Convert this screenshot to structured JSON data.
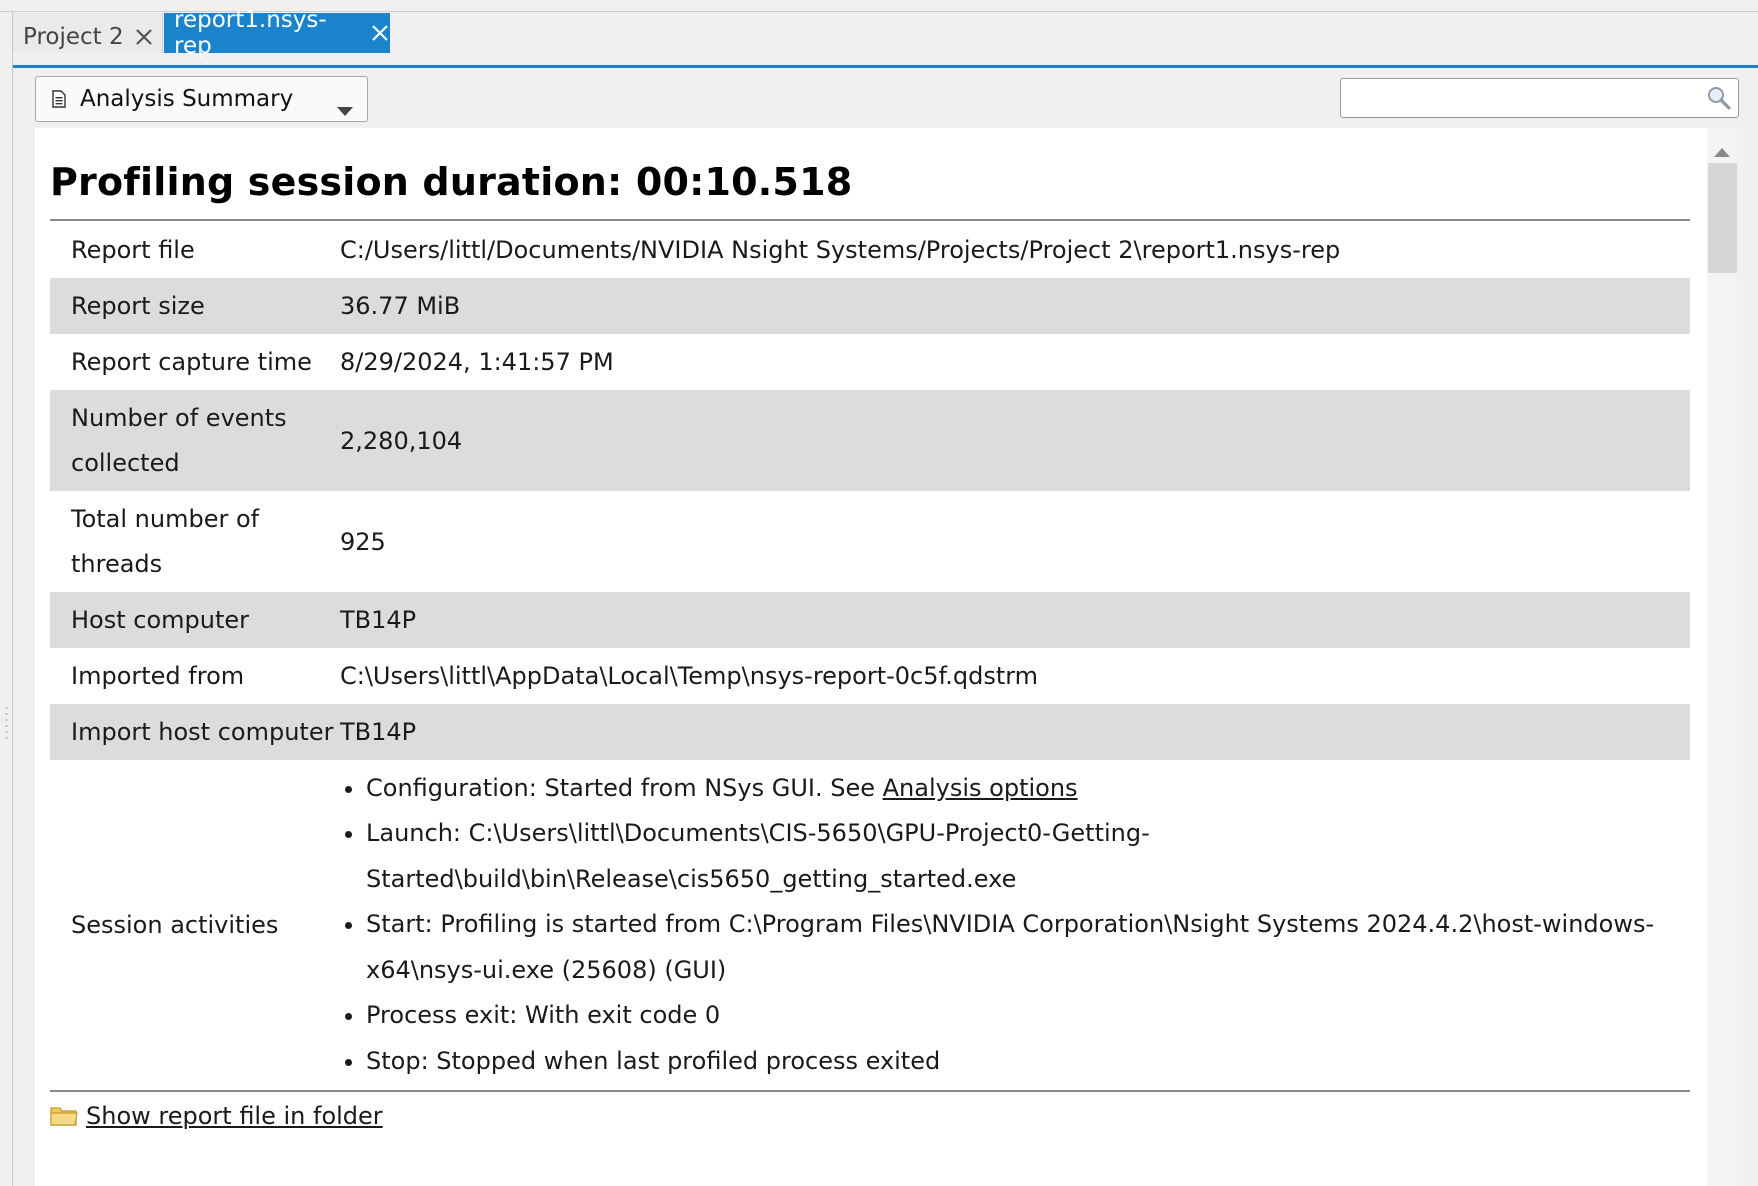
{
  "tabs": [
    {
      "label": "Project 2",
      "active": false
    },
    {
      "label": "report1.nsys-rep",
      "active": true
    }
  ],
  "view_selector": {
    "label": "Analysis Summary"
  },
  "search": {
    "value": "",
    "placeholder": ""
  },
  "summary": {
    "title": "Profiling session duration: 00:10.518",
    "rows": {
      "report_file": {
        "key": "Report file",
        "value": "C:/Users/littl/Documents/NVIDIA Nsight Systems/Projects/Project 2\\report1.nsys-rep"
      },
      "report_size": {
        "key": "Report size",
        "value": "36.77 MiB"
      },
      "capture_time": {
        "key": "Report capture time",
        "value": "8/29/2024, 1:41:57 PM"
      },
      "events": {
        "key_line1": "Number of events",
        "key_line2": "collected",
        "value": "2,280,104"
      },
      "threads": {
        "key_line1": "Total number of",
        "key_line2": "threads",
        "value": "925"
      },
      "host": {
        "key": "Host computer",
        "value": "TB14P"
      },
      "imported_from": {
        "key": "Imported from",
        "value": "C:\\Users\\littl\\AppData\\Local\\Temp\\nsys-report-0c5f.qdstrm"
      },
      "import_host": {
        "key": "Import host computer",
        "value": "TB14P"
      }
    },
    "activities": {
      "key": "Session activities",
      "configuration": {
        "text": "Configuration: Started from NSys GUI. See ",
        "link": "Analysis options"
      },
      "launch_line1": "Launch: C:\\Users\\littl\\Documents\\CIS-5650\\GPU-Project0-Getting-",
      "launch_line2": "Started\\build\\bin\\Release\\cis5650_getting_started.exe",
      "start_line1": "Start: Profiling is started from C:\\Program Files\\NVIDIA Corporation\\Nsight Systems 2024.4.2\\host-windows-",
      "start_line2": "x64\\nsys-ui.exe (25608) (GUI)",
      "process_exit": "Process exit: With exit code 0",
      "stop": "Stop: Stopped when last profiled process exited"
    },
    "show_folder_link": "Show report file in folder"
  },
  "colors": {
    "accent": "#1b82cc",
    "row_alt": "#dcdcdc",
    "content_bg": "#ffffff",
    "chrome_bg": "#f0f0f0"
  },
  "icons": [
    "close-icon",
    "document-icon",
    "chevron-down-icon",
    "search-icon",
    "folder-icon",
    "scroll-up-icon"
  ]
}
